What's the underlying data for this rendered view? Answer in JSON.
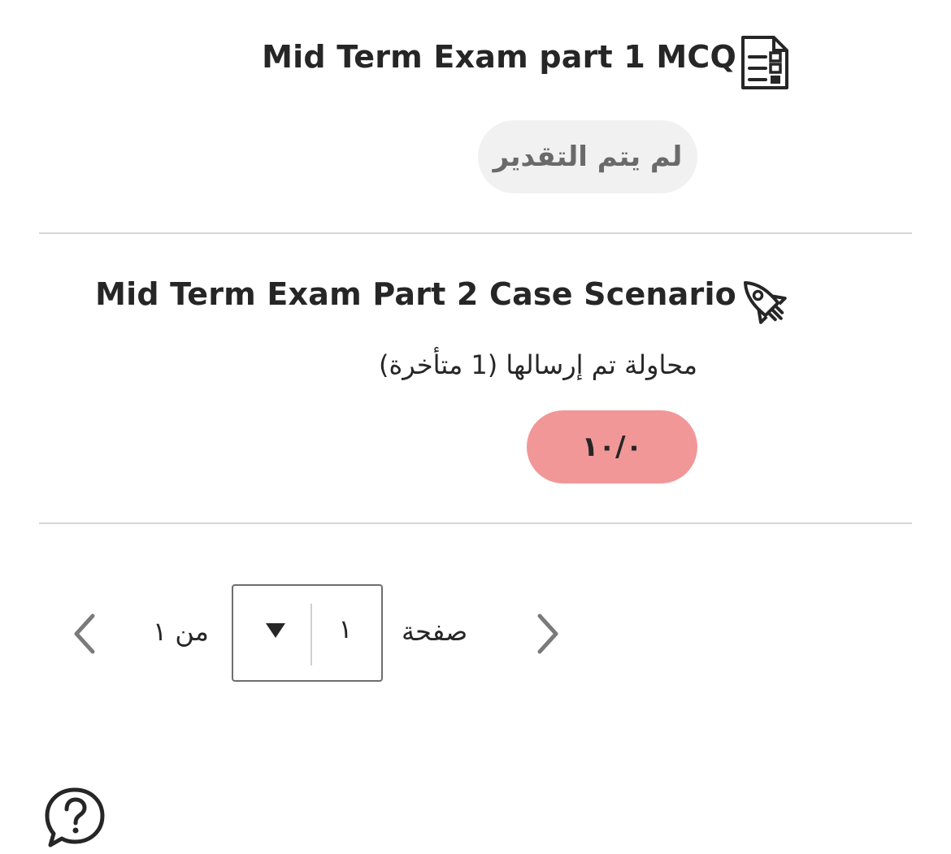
{
  "items": [
    {
      "title": "Mid Term Exam part 1 MCQ",
      "icon": "exam-document-icon",
      "status": "لم يتم التقدير"
    },
    {
      "title": "Mid Term Exam Part 2 Case Scenario",
      "icon": "rocket-icon",
      "attempt_text": "محاولة تم إرسالها (1 متأخرة)",
      "grade": "١٠/٠",
      "grade_color": "#f19797"
    }
  ],
  "pagination": {
    "page_label": "صفحة",
    "current_page": "١",
    "of_text": "من ١",
    "prev_icon": "chevron-left-icon",
    "next_icon": "chevron-right-icon",
    "dropdown_icon": "caret-down-icon"
  },
  "help": {
    "icon": "help-chat-icon"
  }
}
